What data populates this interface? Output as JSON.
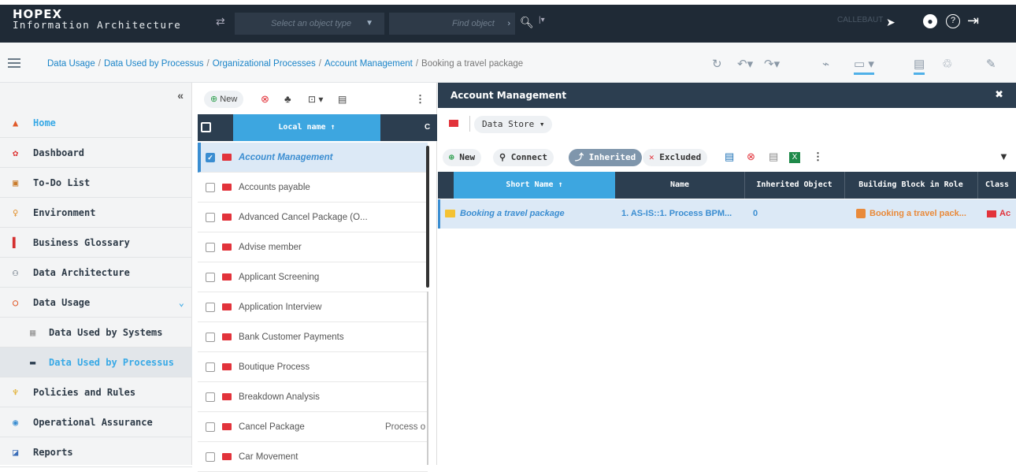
{
  "app": {
    "logo_line1": "HOPEX",
    "logo_line2": "Information Architecture"
  },
  "topbar": {
    "type_placeholder": "Select an object type",
    "find_placeholder": "Find object",
    "user_badge": "CALLEBAUT"
  },
  "breadcrumb": {
    "items": [
      "Data Usage",
      "Data Used by Processus",
      "Organizational Processes",
      "Account Management"
    ],
    "current": "Booking a travel package",
    "separator": "/"
  },
  "sidebar": {
    "items": [
      {
        "label": "Home",
        "icon": "home-icon",
        "color": "#e44"
      },
      {
        "label": "Dashboard",
        "icon": "dashboard-icon"
      },
      {
        "label": "To-Do List",
        "icon": "todo-icon"
      },
      {
        "label": "Environment",
        "icon": "environment-icon"
      },
      {
        "label": "Business Glossary",
        "icon": "glossary-icon"
      },
      {
        "label": "Data Architecture",
        "icon": "data-architecture-icon"
      },
      {
        "label": "Data Usage",
        "icon": "data-usage-icon"
      },
      {
        "label": "Data Used by Systems",
        "icon": "systems-icon"
      },
      {
        "label": "Data Used by Processus",
        "icon": "process-icon"
      },
      {
        "label": "Policies and Rules",
        "icon": "policies-icon"
      },
      {
        "label": "Operational Assurance",
        "icon": "assurance-icon"
      },
      {
        "label": "Reports",
        "icon": "reports-icon"
      }
    ]
  },
  "list": {
    "new_label": "New",
    "header_name": "Local name",
    "header_other": "C",
    "rows": [
      {
        "name": "Account Management",
        "selected": true
      },
      {
        "name": "Accounts payable"
      },
      {
        "name": "Advanced Cancel Package (O..."
      },
      {
        "name": "Advise member"
      },
      {
        "name": "Applicant Screening"
      },
      {
        "name": "Application Interview"
      },
      {
        "name": "Bank Customer Payments"
      },
      {
        "name": "Boutique Process"
      },
      {
        "name": "Breakdown Analysis"
      },
      {
        "name": "Cancel Package",
        "extra": "Process o"
      },
      {
        "name": "Car Movement"
      }
    ]
  },
  "detail": {
    "title": "Account Management",
    "tab_label": "Data Store",
    "toolbar": {
      "new": "New",
      "connect": "Connect",
      "inherited": "Inherited",
      "excluded": "Excluded"
    },
    "columns": [
      "Short Name",
      "Name",
      "Inherited Object",
      "Building Block in Role",
      "Class"
    ],
    "row": {
      "short_name": "Booking a travel package",
      "name": "1. AS-IS::1. Process BPM...",
      "inherited": "0",
      "building_block": "Booking a travel pack...",
      "class": "Ac"
    }
  }
}
